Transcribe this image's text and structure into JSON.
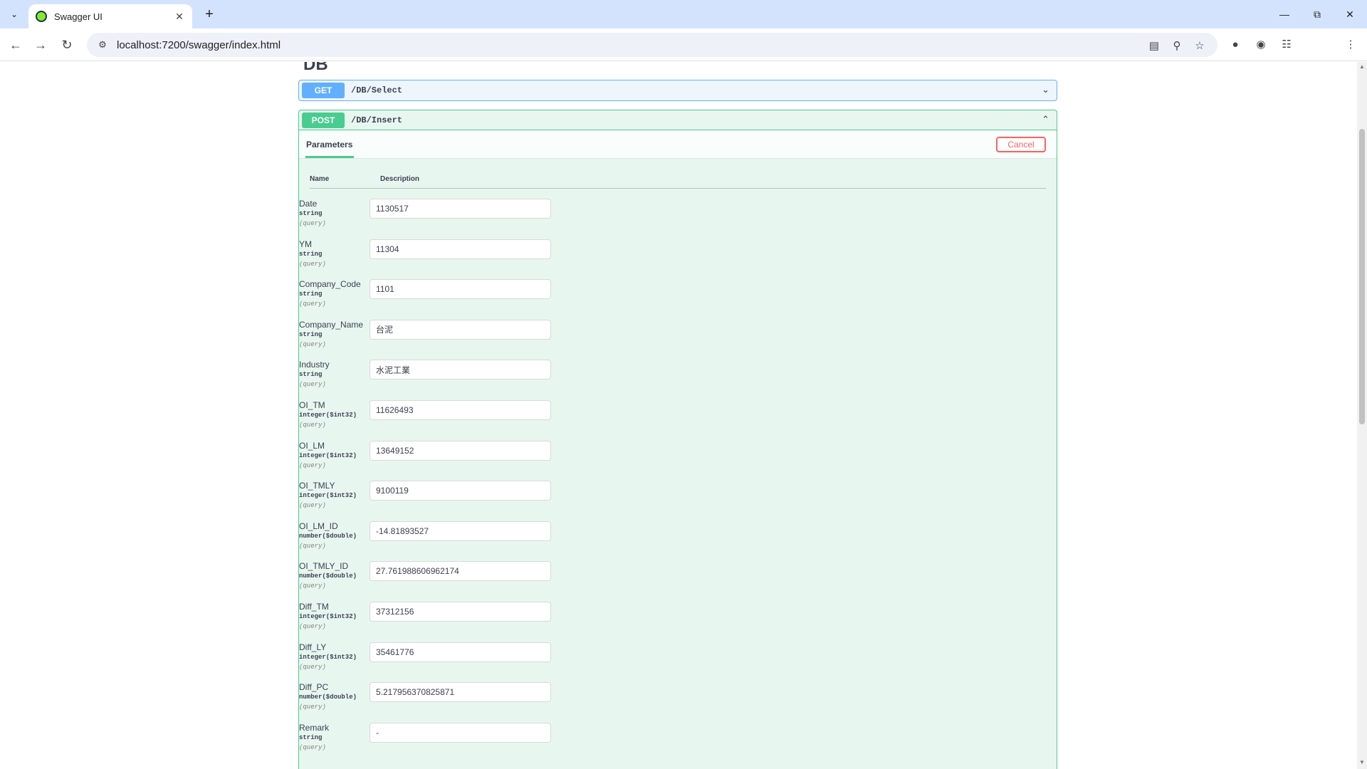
{
  "browser": {
    "tab_title": "Swagger UI",
    "url": "localhost:7200/swagger/index.html"
  },
  "section": {
    "title": "DB"
  },
  "operations": {
    "get": {
      "method": "GET",
      "path": "/DB/Select"
    },
    "post": {
      "method": "POST",
      "path": "/DB/Insert"
    }
  },
  "params_panel": {
    "tab_label": "Parameters",
    "cancel_label": "Cancel",
    "col_name": "Name",
    "col_description": "Description"
  },
  "parameters": [
    {
      "name": "Date",
      "type": "string",
      "in": "(query)",
      "value": "1130517"
    },
    {
      "name": "YM",
      "type": "string",
      "in": "(query)",
      "value": "11304"
    },
    {
      "name": "Company_Code",
      "type": "string",
      "in": "(query)",
      "value": "1101"
    },
    {
      "name": "Company_Name",
      "type": "string",
      "in": "(query)",
      "value": "台泥"
    },
    {
      "name": "Industry",
      "type": "string",
      "in": "(query)",
      "value": "水泥工業"
    },
    {
      "name": "OI_TM",
      "type": "integer($int32)",
      "in": "(query)",
      "value": "11626493"
    },
    {
      "name": "OI_LM",
      "type": "integer($int32)",
      "in": "(query)",
      "value": "13649152"
    },
    {
      "name": "OI_TMLY",
      "type": "integer($int32)",
      "in": "(query)",
      "value": "9100119"
    },
    {
      "name": "OI_LM_ID",
      "type": "number($double)",
      "in": "(query)",
      "value": "-14.81893527"
    },
    {
      "name": "OI_TMLY_ID",
      "type": "number($double)",
      "in": "(query)",
      "value": "27.761988606962174"
    },
    {
      "name": "Diff_TM",
      "type": "integer($int32)",
      "in": "(query)",
      "value": "37312156"
    },
    {
      "name": "Diff_LY",
      "type": "integer($int32)",
      "in": "(query)",
      "value": "35461776"
    },
    {
      "name": "Diff_PC",
      "type": "number($double)",
      "in": "(query)",
      "value": "5.217956370825871"
    },
    {
      "name": "Remark",
      "type": "string",
      "in": "(query)",
      "value": "-"
    }
  ]
}
